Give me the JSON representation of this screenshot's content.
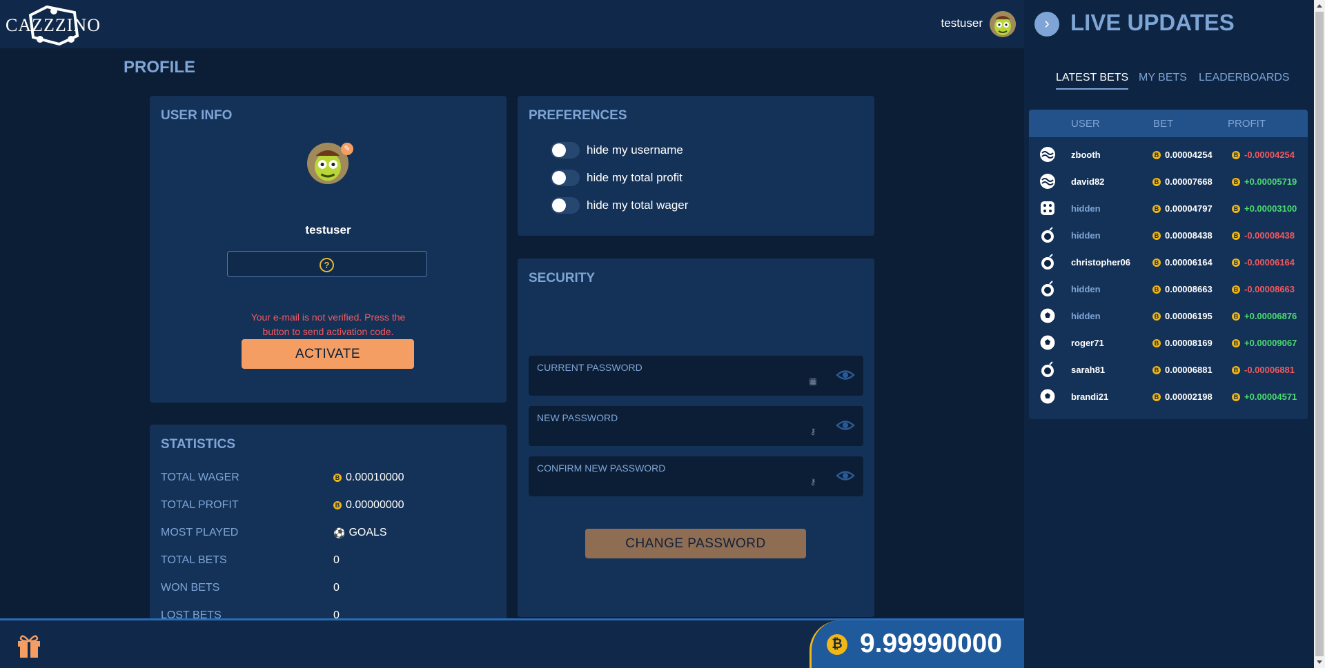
{
  "header": {
    "logo_text": "CAZZZINO",
    "username": "testuser"
  },
  "page": {
    "title": "PROFILE"
  },
  "user_info": {
    "title": "USER INFO",
    "username": "testuser",
    "email_value": "",
    "warning": "Your e-mail is not verified. Press the button to send activation code.",
    "activate_label": "ACTIVATE"
  },
  "preferences": {
    "title": "PREFERENCES",
    "items": [
      {
        "label": "hide my username",
        "on": false
      },
      {
        "label": "hide my total profit",
        "on": false
      },
      {
        "label": "hide my total wager",
        "on": false
      }
    ]
  },
  "security": {
    "title": "SECURITY",
    "fields": [
      {
        "label": "CURRENT PASSWORD",
        "value": ""
      },
      {
        "label": "NEW PASSWORD",
        "value": ""
      },
      {
        "label": "CONFIRM NEW PASSWORD",
        "value": ""
      }
    ],
    "change_label": "CHANGE PASSWORD"
  },
  "statistics": {
    "title": "STATISTICS",
    "rows": [
      {
        "label": "TOTAL WAGER",
        "value": "0.00010000",
        "icon": "bitcoin-coin-icon"
      },
      {
        "label": "TOTAL PROFIT",
        "value": "0.00000000",
        "icon": "bitcoin-coin-icon"
      },
      {
        "label": "MOST PLAYED",
        "value": "GOALS",
        "icon": "soccer-ball-icon"
      },
      {
        "label": "TOTAL BETS",
        "value": "0"
      },
      {
        "label": "WON BETS",
        "value": "0"
      },
      {
        "label": "LOST BETS",
        "value": "0"
      }
    ]
  },
  "footer": {
    "balance": "9.99990000",
    "currency_symbol": "₿"
  },
  "live_updates": {
    "title": "LIVE UPDATES",
    "tabs": [
      "LATEST BETS",
      "MY BETS",
      "LEADERBOARDS"
    ],
    "active_tab": "LATEST BETS",
    "columns": [
      "USER",
      "BET",
      "PROFIT"
    ],
    "rows": [
      {
        "game_icon": "hilo-icon",
        "user": "zbooth",
        "hidden": false,
        "bet": "0.00004254",
        "profit": "-0.00004254",
        "positive": false
      },
      {
        "game_icon": "hilo-icon",
        "user": "david82",
        "hidden": false,
        "bet": "0.00007668",
        "profit": "+0.00005719",
        "positive": true
      },
      {
        "game_icon": "dice-icon",
        "user": "hidden",
        "hidden": true,
        "bet": "0.00004797",
        "profit": "+0.00003100",
        "positive": true
      },
      {
        "game_icon": "bomb-icon",
        "user": "hidden",
        "hidden": true,
        "bet": "0.00008438",
        "profit": "-0.00008438",
        "positive": false
      },
      {
        "game_icon": "bomb-icon",
        "user": "christopher06",
        "hidden": false,
        "bet": "0.00006164",
        "profit": "-0.00006164",
        "positive": false
      },
      {
        "game_icon": "bomb-icon",
        "user": "hidden",
        "hidden": true,
        "bet": "0.00008663",
        "profit": "-0.00008663",
        "positive": false
      },
      {
        "game_icon": "soccer-ball-icon",
        "user": "hidden",
        "hidden": true,
        "bet": "0.00006195",
        "profit": "+0.00006876",
        "positive": true
      },
      {
        "game_icon": "soccer-ball-icon",
        "user": "roger71",
        "hidden": false,
        "bet": "0.00008169",
        "profit": "+0.00009067",
        "positive": true
      },
      {
        "game_icon": "bomb-icon",
        "user": "sarah81",
        "hidden": false,
        "bet": "0.00006881",
        "profit": "-0.00006881",
        "positive": false
      },
      {
        "game_icon": "soccer-ball-icon",
        "user": "brandi21",
        "hidden": false,
        "bet": "0.00002198",
        "profit": "+0.00004571",
        "positive": true
      }
    ]
  },
  "colors": {
    "page_bg": "#0c1e36",
    "card_bg": "#143257",
    "accent_blue": "#7ea5d6",
    "activate_orange": "#f59e63",
    "negative": "#f2585f",
    "positive": "#4cdb72",
    "coin_gold": "#f1b715"
  }
}
